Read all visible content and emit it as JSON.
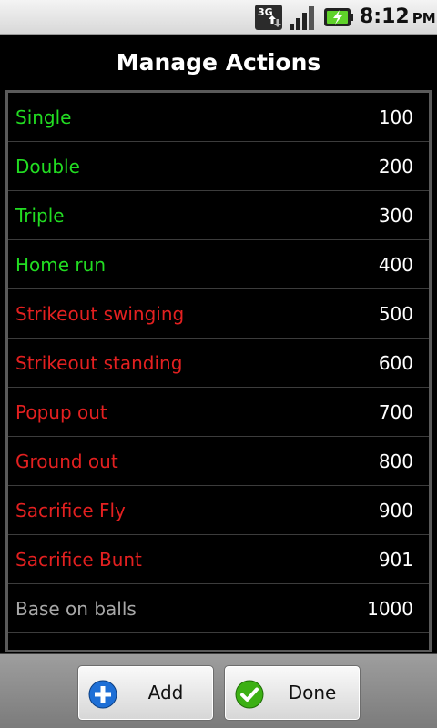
{
  "status_bar": {
    "network_label": "3G",
    "time": "8:12",
    "ampm": "PM",
    "icons": [
      "3g-data-icon",
      "signal-strength-icon",
      "battery-charging-icon"
    ]
  },
  "title": "Manage Actions",
  "colors": {
    "hit": "#22dd22",
    "out": "#e32020",
    "neutral": "#a8a8a8",
    "value": "#ffffff",
    "add_icon": "#1e6fd6",
    "done_icon": "#3cb014"
  },
  "actions": [
    {
      "name": "Single",
      "value": "100",
      "kind": "hit"
    },
    {
      "name": "Double",
      "value": "200",
      "kind": "hit"
    },
    {
      "name": "Triple",
      "value": "300",
      "kind": "hit"
    },
    {
      "name": "Home run",
      "value": "400",
      "kind": "hit"
    },
    {
      "name": "Strikeout swinging",
      "value": "500",
      "kind": "out"
    },
    {
      "name": "Strikeout standing",
      "value": "600",
      "kind": "out"
    },
    {
      "name": "Popup out",
      "value": "700",
      "kind": "out"
    },
    {
      "name": "Ground out",
      "value": "800",
      "kind": "out"
    },
    {
      "name": "Sacrifice Fly",
      "value": "900",
      "kind": "out"
    },
    {
      "name": "Sacrifice Bunt",
      "value": "901",
      "kind": "out"
    },
    {
      "name": "Base on balls",
      "value": "1000",
      "kind": "neutral"
    }
  ],
  "buttons": {
    "add": {
      "label": "Add",
      "icon": "plus-icon"
    },
    "done": {
      "label": "Done",
      "icon": "checkmark-icon"
    }
  }
}
